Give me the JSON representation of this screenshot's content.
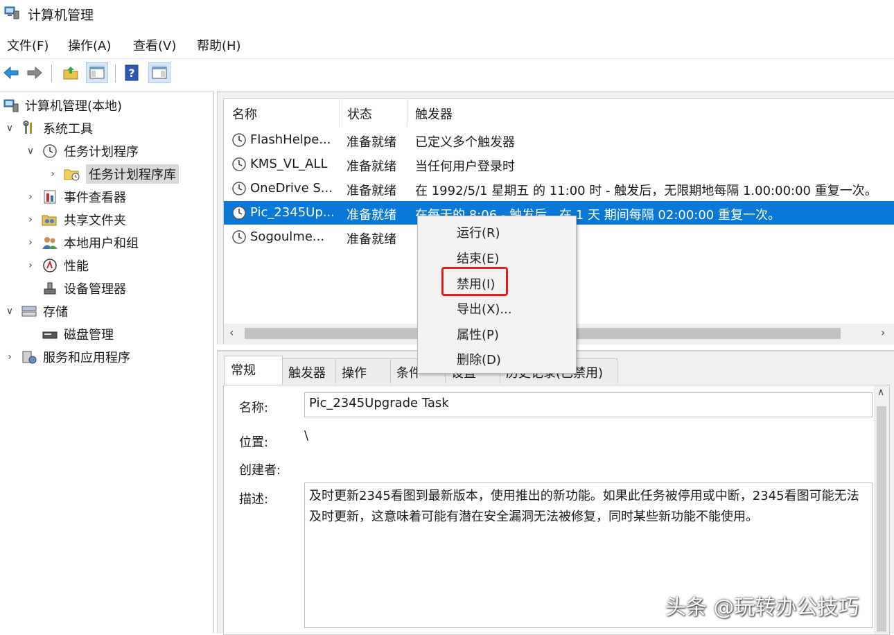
{
  "window": {
    "title": "计算机管理"
  },
  "menubar": {
    "items": [
      "文件(F)",
      "操作(A)",
      "查看(V)",
      "帮助(H)"
    ]
  },
  "toolbar": {
    "buttons": [
      "back-arrow-icon",
      "forward-arrow-icon",
      "up-folder-icon",
      "show-hide-tree-icon",
      "help-icon",
      "show-action-pane-icon"
    ]
  },
  "tree": {
    "root": "计算机管理(本地)",
    "system_tools": "系统工具",
    "task_scheduler": "任务计划程序",
    "task_library": "任务计划程序库",
    "event_viewer": "事件查看器",
    "shared_folders": "共享文件夹",
    "local_users": "本地用户和组",
    "performance": "性能",
    "device_manager": "设备管理器",
    "storage": "存储",
    "disk_management": "磁盘管理",
    "services_apps": "服务和应用程序"
  },
  "task_list": {
    "columns": [
      "名称",
      "状态",
      "触发器"
    ],
    "rows": [
      {
        "name": "FlashHelpe...",
        "status": "准备就绪",
        "trigger": "已定义多个触发器"
      },
      {
        "name": "KMS_VL_ALL",
        "status": "准备就绪",
        "trigger": "当任何用户登录时"
      },
      {
        "name": "OneDrive S...",
        "status": "准备就绪",
        "trigger": "在 1992/5/1 星期五 的 11:00 时 - 触发后，无限期地每隔 1.00:00:00 重复一次。"
      },
      {
        "name": "Pic_2345Up...",
        "status": "准备就绪",
        "trigger": "在每天的 8:06 - 触发后，在 1 天 期间每隔 02:00:00 重复一次。"
      },
      {
        "name": "Sogoulme...",
        "status": "准备就绪",
        "trigger": ""
      }
    ]
  },
  "context_menu": {
    "items": [
      "运行(R)",
      "结束(E)",
      "禁用(I)",
      "导出(X)...",
      "属性(P)",
      "删除(D)"
    ]
  },
  "details": {
    "tabs": [
      "常规",
      "触发器",
      "操作",
      "条件",
      "设置",
      "历史记录(已禁用)"
    ],
    "name_label": "名称:",
    "name_value": "Pic_2345Upgrade Task",
    "location_label": "位置:",
    "location_value": "\\",
    "author_label": "创建者:",
    "description_label": "描述:",
    "description_value": "及时更新2345看图到最新版本，使用推出的新功能。如果此任务被停用或中断，2345看图可能无法及时更新，这意味着可能有潜在安全漏洞无法被修复，同时某些新功能不能使用。"
  },
  "watermark": "头条 @玩转办公技巧",
  "colors": {
    "selection": "#0a78d7",
    "highlight_box": "#e02020"
  }
}
